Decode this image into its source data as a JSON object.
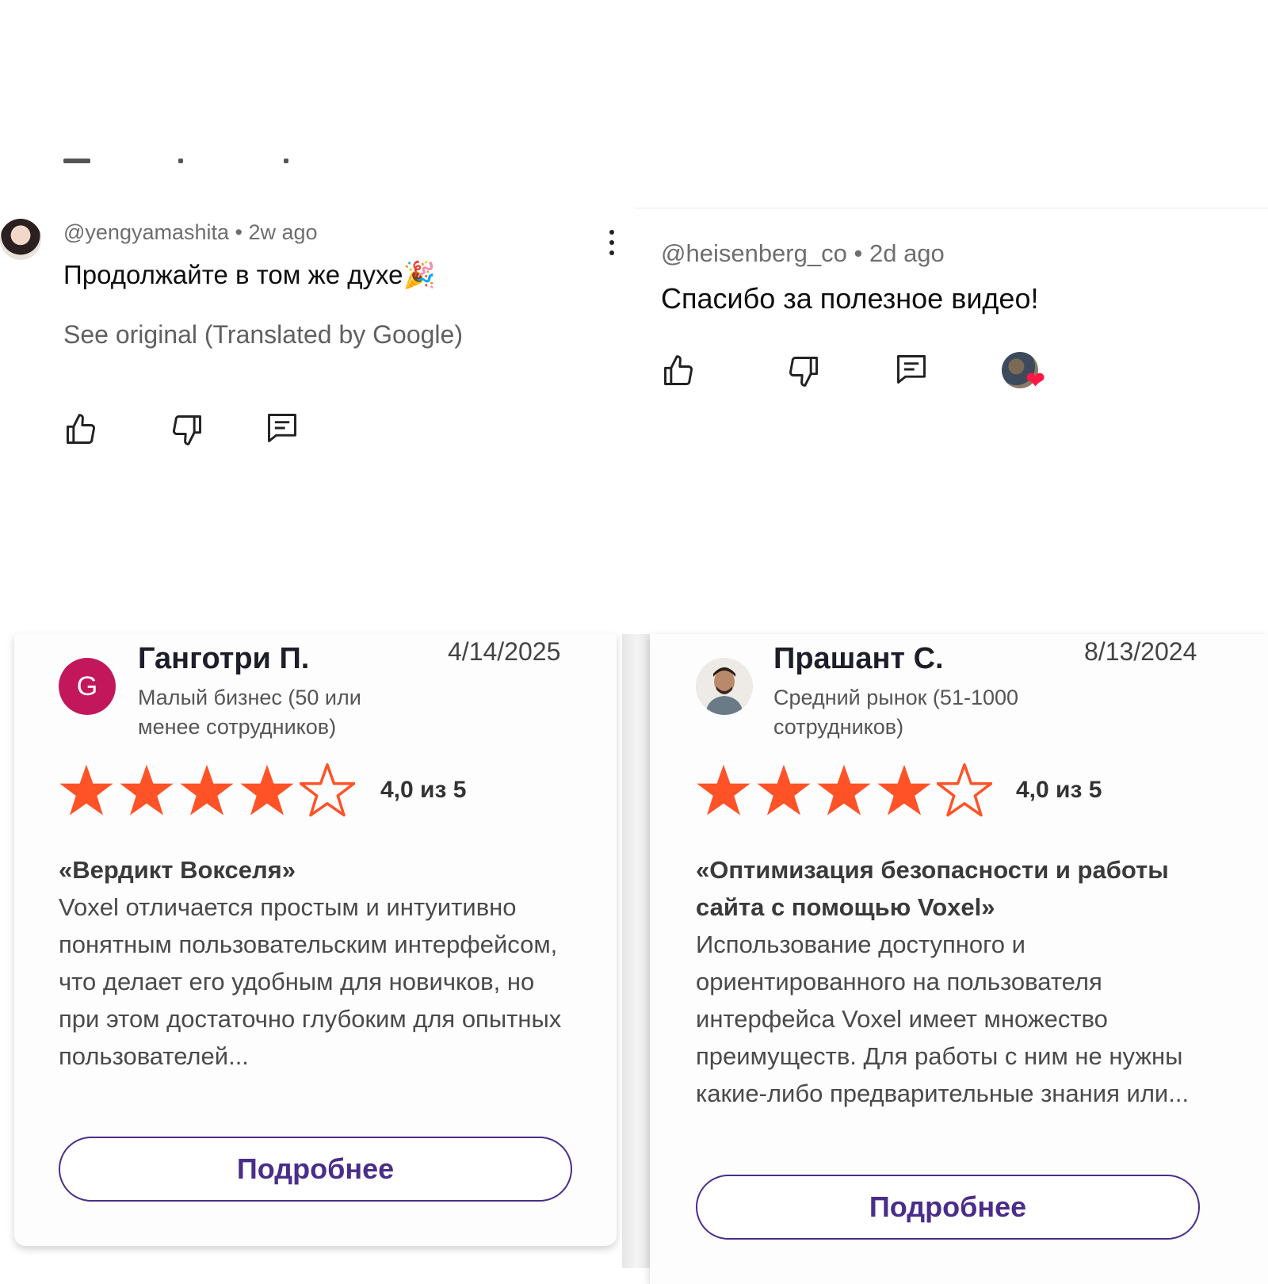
{
  "comments": [
    {
      "handle": "@yengyamashita",
      "age": "2w ago",
      "text": "Продолжайте в том же духе",
      "text_emoji": "🎉",
      "translation_note": "See original (Translated by Google)"
    },
    {
      "handle": "@heisenberg_co",
      "age": "2d ago",
      "text": "Спасибо за полезное видео!",
      "hearted": true
    }
  ],
  "meta_separator": "•",
  "icons": {
    "like": "thumb-up-icon",
    "dislike": "thumb-down-icon",
    "reply": "reply-icon",
    "more": "more-vert-icon",
    "heart": "heart-icon"
  },
  "colors": {
    "star": "#ff5227",
    "button_accent": "#4a2d8a",
    "avatar_g": "#c2185b",
    "heart": "#ff1744"
  },
  "reviews": [
    {
      "avatar_letter": "G",
      "name": "Ганготри П.",
      "date": "4/14/2025",
      "segment": "Малый бизнес (50 или менее сотрудников)",
      "rating": 4,
      "rating_max": 5,
      "score_text": "4,0 из 5",
      "title": "«Вердикт Вокселя»",
      "body": "Voxel отличается простым и интуитивно понятным пользовательским интерфейсом, что делает его удобным для новичков, но при этом достаточно глубоким для опытных пользователей...",
      "button": "Подробнее"
    },
    {
      "avatar_letter": "",
      "name": "Прашант С.",
      "date": "8/13/2024",
      "segment": "Средний рынок (51-1000 сотрудников)",
      "rating": 4,
      "rating_max": 5,
      "score_text": "4,0 из 5",
      "title": "«Оптимизация безопасности и работы сайта с помощью Voxel»",
      "body": "Использование доступного и ориентированного на пользователя интерфейса Voxel имеет множество преимуществ. Для работы с ним не нужны какие-либо предварительные знания или...",
      "button": "Подробнее"
    }
  ]
}
